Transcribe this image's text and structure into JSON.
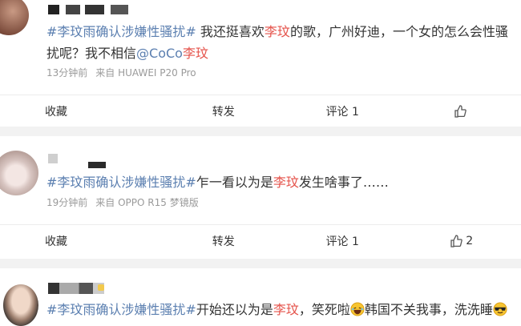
{
  "posts": [
    {
      "tag": "#李玟雨确认涉嫌性骚扰#",
      "text1": " 我还挺喜欢",
      "highlight1": "李玟",
      "text2": "的歌，广州好迪，一个女的怎么会性骚扰呢？我不相信",
      "mention": "@CoCo",
      "mention_highlight": "李玟",
      "time": "13分钟前",
      "source": "来自 HUAWEI P20 Pro",
      "actions": {
        "fav": "收藏",
        "repost": "转发",
        "comment": "评论 1",
        "like_count": ""
      }
    },
    {
      "tag": "#李玟雨确认涉嫌性骚扰#",
      "text1": "乍一看以为是",
      "highlight1": "李玟",
      "text2": "发生啥事了……",
      "time": "19分钟前",
      "source": "来自 OPPO R15 梦镜版",
      "actions": {
        "fav": "收藏",
        "repost": "转发",
        "comment": "评论 1",
        "like_count": "2"
      }
    },
    {
      "tag": "#李玟雨确认涉嫌性骚扰#",
      "text1": "开始还以为是",
      "highlight1": "李玟",
      "text2": "，笑死啦",
      "text3": "韩国不关我事，洗洗睡",
      "emoji1": "laughing-emoji",
      "emoji2": "sunglasses-emoji"
    }
  ],
  "colors": {
    "tag": "#5b7fb0",
    "highlight": "#e5534b",
    "meta": "#9a9a9a",
    "gap": "#f2f2f2"
  }
}
